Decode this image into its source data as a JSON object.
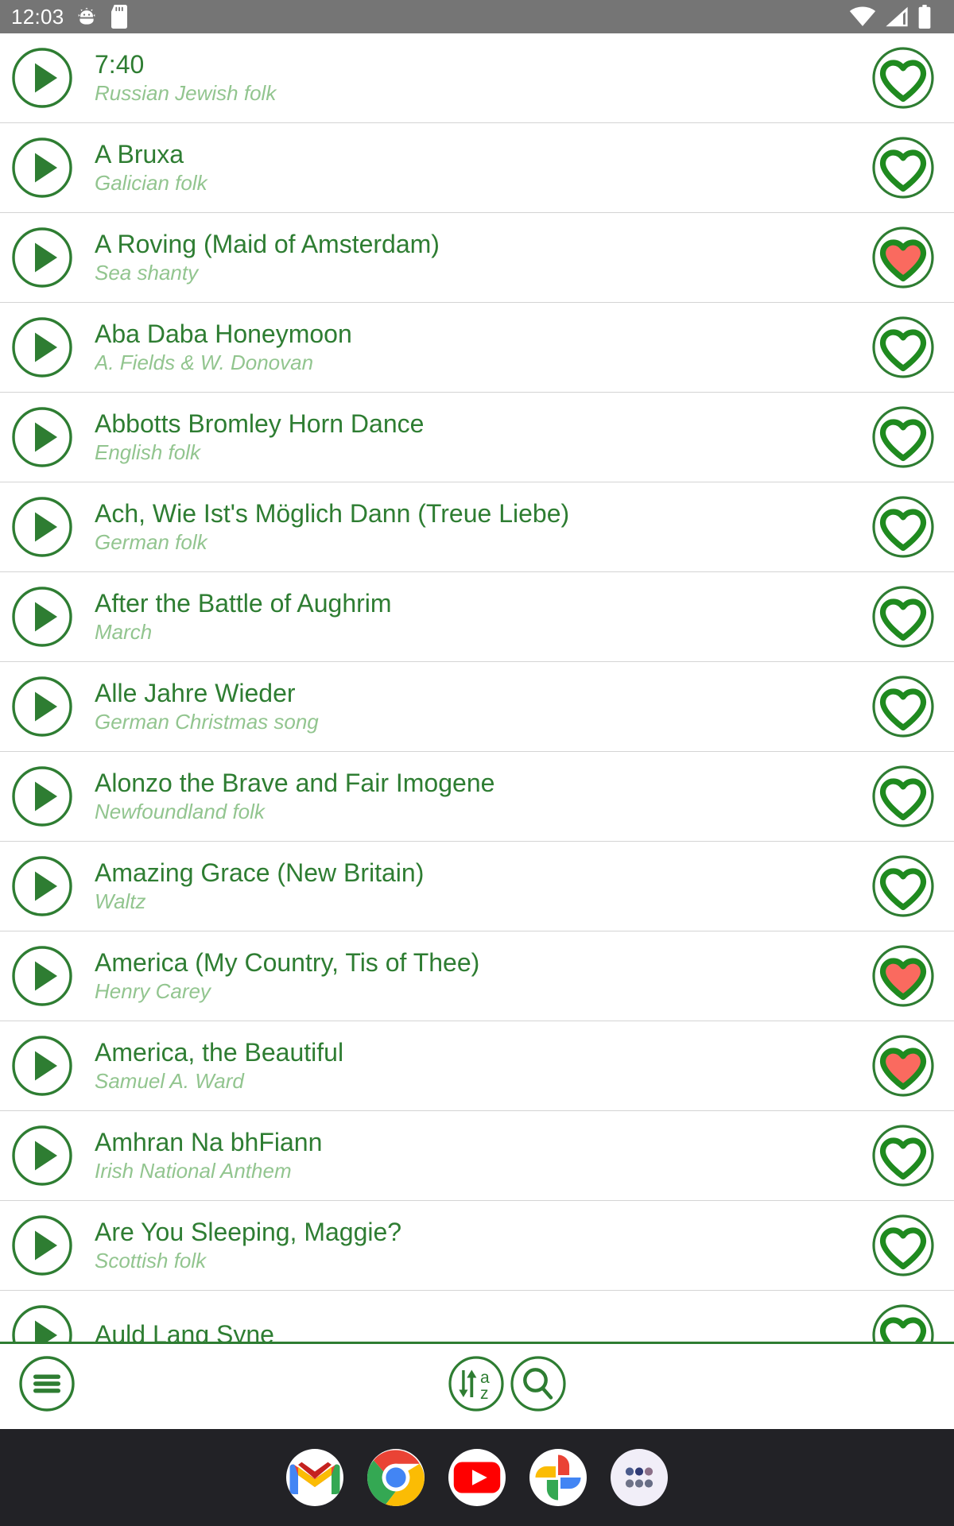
{
  "status_bar": {
    "clock": "12:03",
    "left_icons": [
      "settings-gear-icon",
      "sd-card-icon"
    ],
    "right_icons": [
      "wifi-icon",
      "cellular-signal-icon",
      "battery-icon"
    ],
    "background_color": "#757575"
  },
  "theme": {
    "accent_green": "#2E7D32",
    "subtitle_green": "#92c58f",
    "favorite_red": "#FA6A5F",
    "divider_gray": "#d4d4d4",
    "dock_background": "#222226"
  },
  "song_list": {
    "name": "song-list",
    "items": [
      {
        "title": "7:40",
        "subtitle": "Russian Jewish folk",
        "favorite": false
      },
      {
        "title": "A Bruxa",
        "subtitle": "Galician folk",
        "favorite": false
      },
      {
        "title": "A Roving (Maid of Amsterdam)",
        "subtitle": "Sea shanty",
        "favorite": true
      },
      {
        "title": "Aba Daba Honeymoon",
        "subtitle": "A. Fields & W. Donovan",
        "favorite": false
      },
      {
        "title": "Abbotts Bromley Horn Dance",
        "subtitle": "English folk",
        "favorite": false
      },
      {
        "title": "Ach, Wie Ist's Möglich Dann (Treue Liebe)",
        "subtitle": "German folk",
        "favorite": false
      },
      {
        "title": "After the Battle of Aughrim",
        "subtitle": "March",
        "favorite": false
      },
      {
        "title": "Alle Jahre Wieder",
        "subtitle": "German Christmas song",
        "favorite": false
      },
      {
        "title": "Alonzo the Brave and Fair Imogene",
        "subtitle": "Newfoundland folk",
        "favorite": false
      },
      {
        "title": "Amazing Grace (New Britain)",
        "subtitle": "Waltz",
        "favorite": false
      },
      {
        "title": "America (My Country, Tis of Thee)",
        "subtitle": "Henry Carey",
        "favorite": true
      },
      {
        "title": "America, the Beautiful",
        "subtitle": "Samuel A. Ward",
        "favorite": true
      },
      {
        "title": "Amhran Na bhFiann",
        "subtitle": "Irish National Anthem",
        "favorite": false
      },
      {
        "title": "Are You Sleeping, Maggie?",
        "subtitle": "Scottish folk",
        "favorite": false
      },
      {
        "title": "Auld Lang Syne",
        "subtitle": "",
        "favorite": false
      }
    ],
    "play_icon": "play-icon",
    "favorite_icon": "heart-icon"
  },
  "bottom_bar": {
    "menu_icon": "hamburger-menu-icon",
    "sort_icon": "sort-alphabetical-icon",
    "sort_label_top": "a",
    "sort_label_bottom": "z",
    "search_icon": "search-icon"
  },
  "dock": {
    "apps": [
      {
        "name": "gmail-app-icon",
        "label": "Gmail"
      },
      {
        "name": "chrome-app-icon",
        "label": "Chrome"
      },
      {
        "name": "youtube-app-icon",
        "label": "YouTube"
      },
      {
        "name": "google-photos-app-icon",
        "label": "Photos"
      },
      {
        "name": "app-drawer-icon",
        "label": "All apps"
      }
    ]
  }
}
